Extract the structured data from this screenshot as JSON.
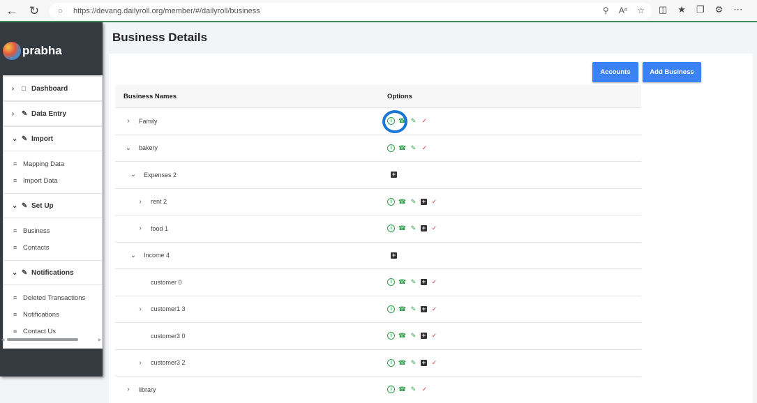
{
  "browser": {
    "url": "https://devang.dailyroll.org/member/#/dailyroll/business"
  },
  "sidebar": {
    "brand": "prabha",
    "groups": [
      {
        "label": "Dashboard",
        "expanded": false,
        "items": []
      },
      {
        "label": "Data Entry",
        "expanded": false,
        "items": []
      },
      {
        "label": "Import",
        "expanded": true,
        "items": [
          "Mapping Data",
          "Import Data"
        ]
      },
      {
        "label": "Set Up",
        "expanded": true,
        "items": [
          "Business",
          "Contacts"
        ]
      },
      {
        "label": "Notifications",
        "expanded": true,
        "items": [
          "Deleted Transactions",
          "Notifications",
          "Contact Us"
        ]
      }
    ]
  },
  "page": {
    "title": "Business Details",
    "buttons": {
      "accounts": "Accounts",
      "add_business": "Add Business"
    }
  },
  "table": {
    "headers": {
      "names": "Business Names",
      "options": "Options"
    },
    "rows": [
      {
        "name": "Family",
        "level": 0,
        "chevron": "right",
        "options": "full"
      },
      {
        "name": "bakery",
        "level": 0,
        "chevron": "down",
        "options": "full"
      },
      {
        "name": "Expenses 2",
        "level": 1,
        "chevron": "down",
        "options": "add"
      },
      {
        "name": "rent 2",
        "level": 2,
        "chevron": "right",
        "options": "full_add"
      },
      {
        "name": "food 1",
        "level": 2,
        "chevron": "right",
        "options": "full_add"
      },
      {
        "name": "Income 4",
        "level": 1,
        "chevron": "down",
        "options": "add"
      },
      {
        "name": "customer 0",
        "level": 2,
        "chevron": "none",
        "options": "full_add"
      },
      {
        "name": "customer1 3",
        "level": 2,
        "chevron": "right",
        "options": "full_add"
      },
      {
        "name": "customer3 0",
        "level": 2,
        "chevron": "none",
        "options": "full_add"
      },
      {
        "name": "customer3 2",
        "level": 2,
        "chevron": "right",
        "options": "full_add"
      },
      {
        "name": "library",
        "level": 0,
        "chevron": "right",
        "options": "full"
      }
    ]
  },
  "colors": {
    "primary_button": "#3b82f6",
    "sidebar_bg": "#343a40",
    "icon_green": "#2e9e4b",
    "icon_red": "#d13a3a",
    "annotation_circle": "#1976d2"
  }
}
